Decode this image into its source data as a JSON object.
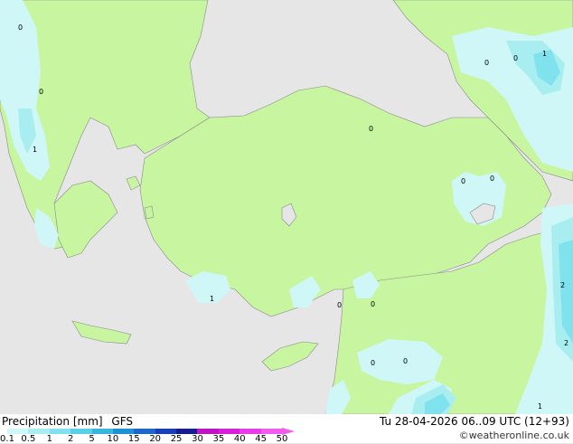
{
  "footer": {
    "title_left": "Precipitation [mm]",
    "model": "GFS",
    "datetime": "Tu 28-04-2026 06..09 UTC (12+93)",
    "credit": "©weatheronline.co.uk"
  },
  "colorbar": {
    "ticks": [
      "0.1",
      "0.5",
      "1",
      "2",
      "5",
      "10",
      "15",
      "20",
      "25",
      "30",
      "35",
      "40",
      "45",
      "50"
    ],
    "colors": [
      "#d0f7f7",
      "#a8eef0",
      "#80e2ec",
      "#5ccfe6",
      "#38b6de",
      "#2090d6",
      "#1c68c8",
      "#1a40b8",
      "#141e8c",
      "#c014c0",
      "#d820d8",
      "#e83ce8",
      "#f05cf0"
    ]
  },
  "map_labels": [
    {
      "text": "0"
    },
    {
      "text": "0"
    },
    {
      "text": "1"
    },
    {
      "text": "0"
    },
    {
      "text": "0"
    },
    {
      "text": "1"
    },
    {
      "text": "0"
    },
    {
      "text": "0"
    },
    {
      "text": "0"
    },
    {
      "text": "1"
    },
    {
      "text": "0"
    },
    {
      "text": "0"
    },
    {
      "text": "0"
    },
    {
      "text": "0"
    },
    {
      "text": "2"
    },
    {
      "text": "2"
    },
    {
      "text": "1"
    }
  ]
}
